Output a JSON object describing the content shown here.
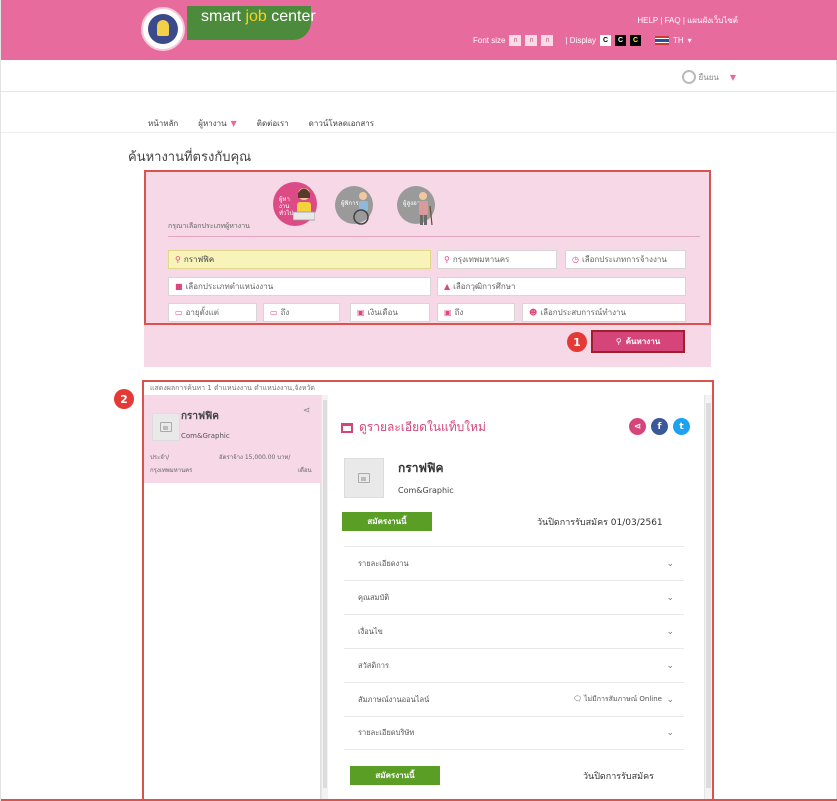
{
  "header": {
    "logo_text_1": "smart ",
    "logo_text_2": "job",
    "logo_text_3": " center",
    "top_links": "HELP | FAQ | แผนผังเว็บไซต์",
    "font_size_label": "Font size",
    "font_buttons": [
      "ก",
      "ก",
      "ก"
    ],
    "display_label": "| Display",
    "display_buttons": [
      "C",
      "C",
      "C"
    ],
    "language": "TH"
  },
  "user": {
    "label": "ยืนยน"
  },
  "nav": {
    "items": [
      "หน้าหลัก",
      "ผู้หางาน",
      "ติดต่อเรา",
      "ดาวน์โหลดเอกสาร"
    ]
  },
  "page_title": "ค้นหางานที่ตรงกับคุณ",
  "search": {
    "seeker_type_label": "กรุณาเลือกประเภทผู้หางาน",
    "seeker_types": [
      {
        "label": "ผู้หางานทั่วไป",
        "active": true
      },
      {
        "label": "ผู้พิการ",
        "active": false
      },
      {
        "label": "ผู้สูงอายุ",
        "active": false
      }
    ],
    "keyword_value": "กราฟฟิค",
    "province_value": "กรุงเทพมหานคร",
    "employment_type_placeholder": "เลือกประเภทการจ้างงาน",
    "position_type_placeholder": "เลือกประเภทตำแหน่งงาน",
    "education_placeholder": "เลือกวุฒิการศึกษา",
    "age_from_placeholder": "อายุตั้งแต่",
    "age_to_placeholder": "ถึง",
    "salary_placeholder": "เงินเดือน",
    "salary_to_placeholder": "ถึง",
    "experience_placeholder": "เลือกประสบการณ์ทำงาน",
    "search_button": "ค้นหางาน",
    "step_1": "1"
  },
  "results": {
    "step_2": "2",
    "summary": "แสดงผลการค้นหา 1 ตำแหน่งงาน ตำแหน่งงาน,จังหวัด",
    "list": [
      {
        "title": "กราฟฟิค",
        "company": "Com&Graphic",
        "type": "ประจำ/",
        "wage": "อัตราจ้าง 15,000.00 บาท/",
        "province": "กรุงเทพมหานคร",
        "per": "เดือน"
      }
    ]
  },
  "detail": {
    "open_new_tab": "ดูรายละเอียดในแท็บใหม่",
    "title": "กราฟฟิค",
    "company": "Com&Graphic",
    "apply_button": "สมัครงานนี้",
    "deadline": "วันปิดการรับสมัคร 01/03/2561",
    "deadline_bottom": "วันปิดการรับสมัคร",
    "sections": [
      {
        "label": "รายละเอียดงาน",
        "extra": ""
      },
      {
        "label": "คุณสมบัติ",
        "extra": ""
      },
      {
        "label": "เงื่อนไข",
        "extra": ""
      },
      {
        "label": "สวัสดิการ",
        "extra": ""
      },
      {
        "label": "สัมภาษณ์งานออนไลน์",
        "extra": "ไม่มีการสัมภาษณ์ Online"
      },
      {
        "label": "รายละเอียดบริษัท",
        "extra": ""
      }
    ]
  },
  "colors": {
    "brand_pink": "#e86b9e",
    "accent_pink": "#d54579",
    "apply_green": "#5a9e25",
    "annotation_red": "#d9534f"
  }
}
